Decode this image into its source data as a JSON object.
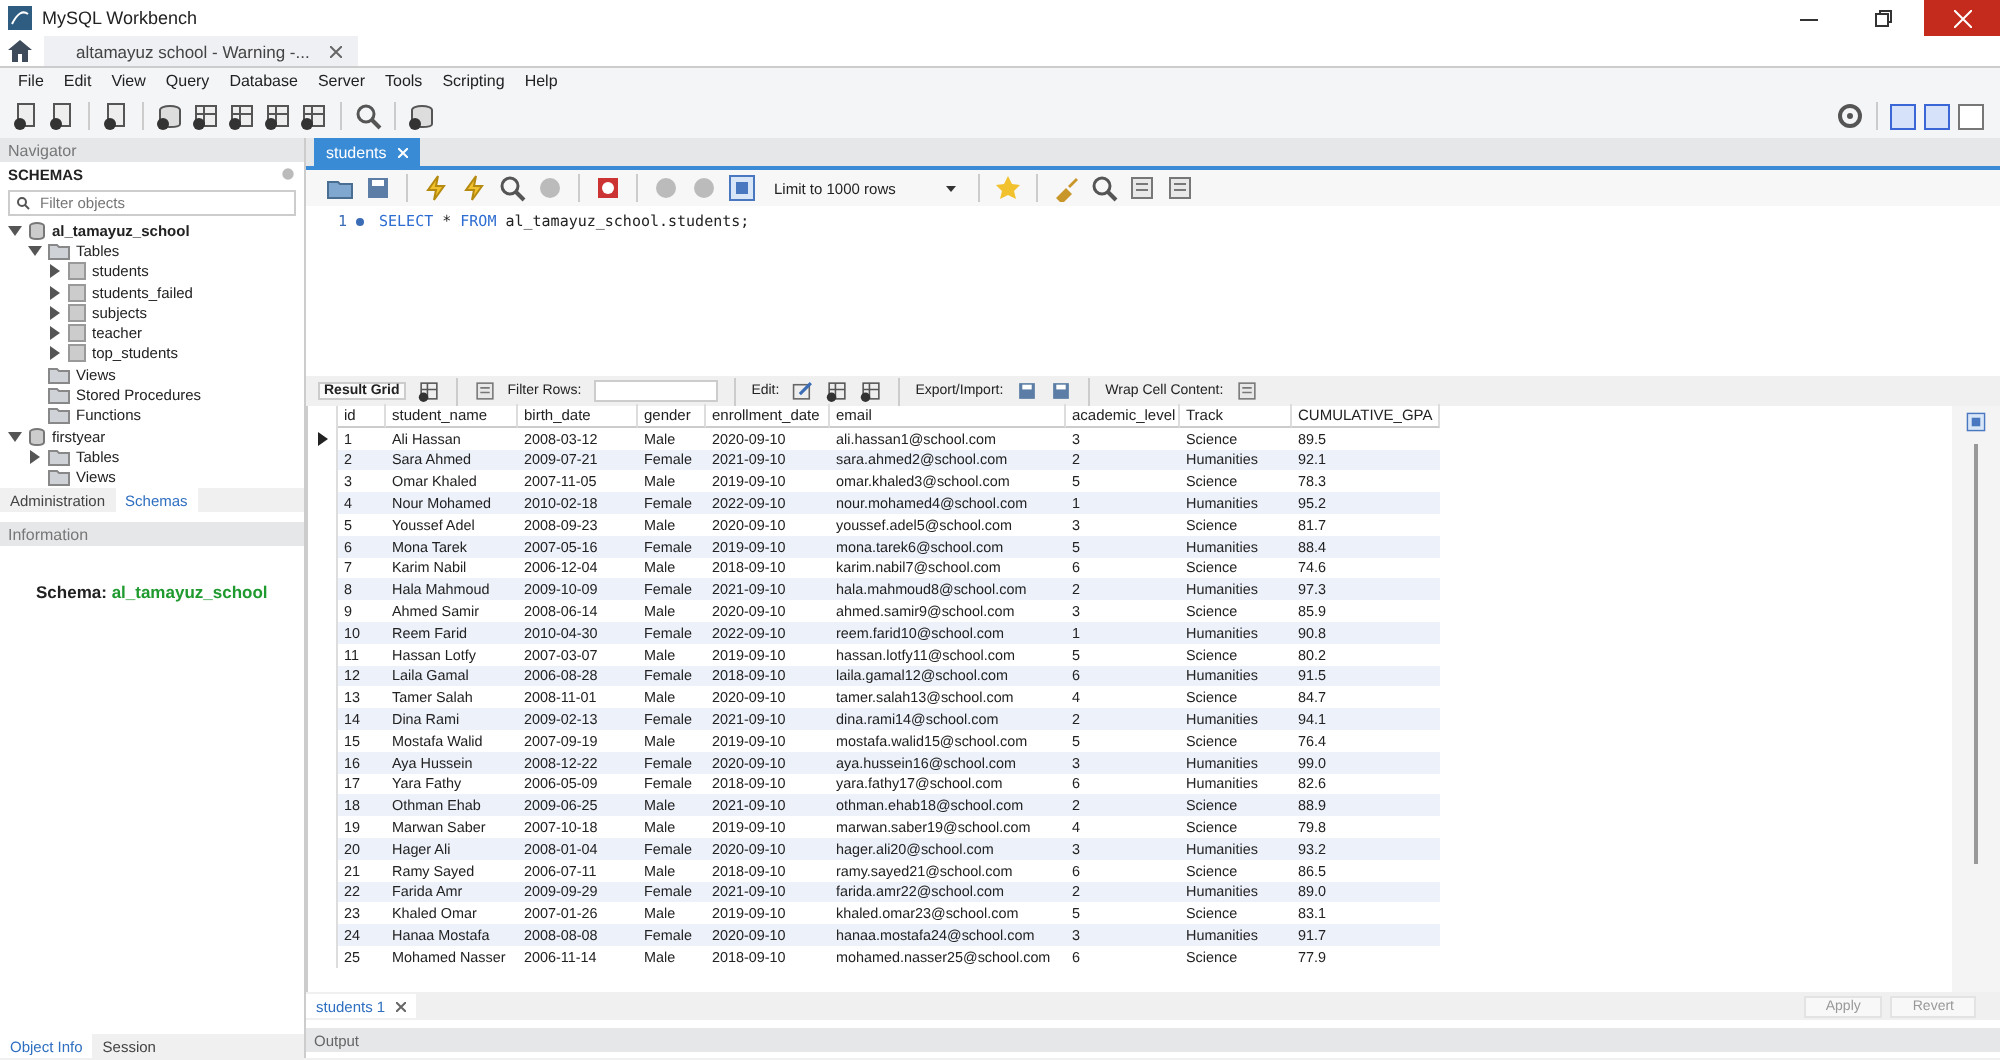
{
  "window": {
    "title": "MySQL Workbench",
    "tab": "altamayuz school - Warning -..."
  },
  "menu": [
    "File",
    "Edit",
    "View",
    "Query",
    "Database",
    "Server",
    "Tools",
    "Scripting",
    "Help"
  ],
  "layout_toggles": [
    {
      "on": true
    },
    {
      "on": true
    },
    {
      "on": false
    }
  ],
  "navigator": {
    "title": "Navigator",
    "schemas_label": "SCHEMAS",
    "filter_placeholder": "Filter objects",
    "tree": [
      {
        "label": "al_tamayuz_school",
        "kind": "schema",
        "default": true,
        "expanded": true,
        "children": [
          {
            "label": "Tables",
            "kind": "folder",
            "expanded": true,
            "children": [
              {
                "label": "students",
                "kind": "table",
                "expanded": false
              },
              {
                "label": "students_failed",
                "kind": "table",
                "expanded": false
              },
              {
                "label": "subjects",
                "kind": "table",
                "expanded": false
              },
              {
                "label": "teacher",
                "kind": "table",
                "expanded": false
              },
              {
                "label": "top_students",
                "kind": "table",
                "expanded": false
              }
            ]
          },
          {
            "label": "Views",
            "kind": "folder"
          },
          {
            "label": "Stored Procedures",
            "kind": "folder"
          },
          {
            "label": "Functions",
            "kind": "folder"
          }
        ]
      },
      {
        "label": "firstyear",
        "kind": "schema",
        "default": false,
        "expanded": true,
        "children": [
          {
            "label": "Tables",
            "kind": "folder",
            "expanded": false
          },
          {
            "label": "Views",
            "kind": "folder"
          }
        ]
      }
    ],
    "tabs": [
      {
        "label": "Administration",
        "selected": false
      },
      {
        "label": "Schemas",
        "selected": true
      }
    ]
  },
  "information": {
    "title": "Information",
    "schema_label": "Schema:",
    "schema_name": "al_tamayuz_school",
    "tabs": [
      {
        "label": "Object Info",
        "selected": true
      },
      {
        "label": "Session",
        "selected": false
      }
    ]
  },
  "editor": {
    "tab": "students",
    "limit": "Limit to 1000 rows",
    "line_number": "1",
    "sql": [
      {
        "text": "SELECT",
        "kind": "keyword"
      },
      {
        "text": " * ",
        "kind": "plain"
      },
      {
        "text": "FROM",
        "kind": "keyword"
      },
      {
        "text": " al_tamayuz_school.students;",
        "kind": "plain"
      }
    ]
  },
  "result": {
    "view_label": "Result Grid",
    "filter_label": "Filter Rows:",
    "edit_label": "Edit:",
    "export_label": "Export/Import:",
    "wrap_label": "Wrap Cell Content:",
    "columns": [
      "id",
      "student_name",
      "birth_date",
      "gender",
      "enrollment_date",
      "email",
      "academic_level",
      "Track",
      "CUMULATIVE_GPA"
    ],
    "rows": [
      {
        "selected": true,
        "cells": [
          "1",
          "Ali Hassan",
          "2008-03-12",
          "Male",
          "2020-09-10",
          "ali.hassan1@school.com",
          "3",
          "Science",
          "89.5"
        ]
      },
      {
        "selected": false,
        "cells": [
          "2",
          "Sara Ahmed",
          "2009-07-21",
          "Female",
          "2021-09-10",
          "sara.ahmed2@school.com",
          "2",
          "Humanities",
          "92.1"
        ]
      },
      {
        "selected": false,
        "cells": [
          "3",
          "Omar Khaled",
          "2007-11-05",
          "Male",
          "2019-09-10",
          "omar.khaled3@school.com",
          "5",
          "Science",
          "78.3"
        ]
      },
      {
        "selected": false,
        "cells": [
          "4",
          "Nour Mohamed",
          "2010-02-18",
          "Female",
          "2022-09-10",
          "nour.mohamed4@school.com",
          "1",
          "Humanities",
          "95.2"
        ]
      },
      {
        "selected": false,
        "cells": [
          "5",
          "Youssef Adel",
          "2008-09-23",
          "Male",
          "2020-09-10",
          "youssef.adel5@school.com",
          "3",
          "Science",
          "81.7"
        ]
      },
      {
        "selected": false,
        "cells": [
          "6",
          "Mona Tarek",
          "2007-05-16",
          "Female",
          "2019-09-10",
          "mona.tarek6@school.com",
          "5",
          "Humanities",
          "88.4"
        ]
      },
      {
        "selected": false,
        "cells": [
          "7",
          "Karim Nabil",
          "2006-12-04",
          "Male",
          "2018-09-10",
          "karim.nabil7@school.com",
          "6",
          "Science",
          "74.6"
        ]
      },
      {
        "selected": false,
        "cells": [
          "8",
          "Hala Mahmoud",
          "2009-10-09",
          "Female",
          "2021-09-10",
          "hala.mahmoud8@school.com",
          "2",
          "Humanities",
          "97.3"
        ]
      },
      {
        "selected": false,
        "cells": [
          "9",
          "Ahmed Samir",
          "2008-06-14",
          "Male",
          "2020-09-10",
          "ahmed.samir9@school.com",
          "3",
          "Science",
          "85.9"
        ]
      },
      {
        "selected": false,
        "cells": [
          "10",
          "Reem Farid",
          "2010-04-30",
          "Female",
          "2022-09-10",
          "reem.farid10@school.com",
          "1",
          "Humanities",
          "90.8"
        ]
      },
      {
        "selected": false,
        "cells": [
          "11",
          "Hassan Lotfy",
          "2007-03-07",
          "Male",
          "2019-09-10",
          "hassan.lotfy11@school.com",
          "5",
          "Science",
          "80.2"
        ]
      },
      {
        "selected": false,
        "cells": [
          "12",
          "Laila Gamal",
          "2006-08-28",
          "Female",
          "2018-09-10",
          "laila.gamal12@school.com",
          "6",
          "Humanities",
          "91.5"
        ]
      },
      {
        "selected": false,
        "cells": [
          "13",
          "Tamer Salah",
          "2008-11-01",
          "Male",
          "2020-09-10",
          "tamer.salah13@school.com",
          "4",
          "Science",
          "84.7"
        ]
      },
      {
        "selected": false,
        "cells": [
          "14",
          "Dina Rami",
          "2009-02-13",
          "Female",
          "2021-09-10",
          "dina.rami14@school.com",
          "2",
          "Humanities",
          "94.1"
        ]
      },
      {
        "selected": false,
        "cells": [
          "15",
          "Mostafa Walid",
          "2007-09-19",
          "Male",
          "2019-09-10",
          "mostafa.walid15@school.com",
          "5",
          "Science",
          "76.4"
        ]
      },
      {
        "selected": false,
        "cells": [
          "16",
          "Aya Hussein",
          "2008-12-22",
          "Female",
          "2020-09-10",
          "aya.hussein16@school.com",
          "3",
          "Humanities",
          "99.0"
        ]
      },
      {
        "selected": false,
        "cells": [
          "17",
          "Yara Fathy",
          "2006-05-09",
          "Female",
          "2018-09-10",
          "yara.fathy17@school.com",
          "6",
          "Humanities",
          "82.6"
        ]
      },
      {
        "selected": false,
        "cells": [
          "18",
          "Othman Ehab",
          "2009-06-25",
          "Male",
          "2021-09-10",
          "othman.ehab18@school.com",
          "2",
          "Science",
          "88.9"
        ]
      },
      {
        "selected": false,
        "cells": [
          "19",
          "Marwan Saber",
          "2007-10-18",
          "Male",
          "2019-09-10",
          "marwan.saber19@school.com",
          "4",
          "Science",
          "79.8"
        ]
      },
      {
        "selected": false,
        "cells": [
          "20",
          "Hager Ali",
          "2008-01-04",
          "Female",
          "2020-09-10",
          "hager.ali20@school.com",
          "3",
          "Humanities",
          "93.2"
        ]
      },
      {
        "selected": false,
        "cells": [
          "21",
          "Ramy Sayed",
          "2006-07-11",
          "Male",
          "2018-09-10",
          "ramy.sayed21@school.com",
          "6",
          "Science",
          "86.5"
        ]
      },
      {
        "selected": false,
        "cells": [
          "22",
          "Farida Amr",
          "2009-09-29",
          "Female",
          "2021-09-10",
          "farida.amr22@school.com",
          "2",
          "Humanities",
          "89.0"
        ]
      },
      {
        "selected": false,
        "cells": [
          "23",
          "Khaled Omar",
          "2007-01-26",
          "Male",
          "2019-09-10",
          "khaled.omar23@school.com",
          "5",
          "Science",
          "83.1"
        ]
      },
      {
        "selected": false,
        "cells": [
          "24",
          "Hanaa Mostafa",
          "2008-08-08",
          "Female",
          "2020-09-10",
          "hanaa.mostafa24@school.com",
          "3",
          "Humanities",
          "91.7"
        ]
      },
      {
        "selected": false,
        "cells": [
          "25",
          "Mohamed Nasser",
          "2006-11-14",
          "Male",
          "2018-09-10",
          "mohamed.nasser25@school.com",
          "6",
          "Science",
          "77.9"
        ]
      }
    ],
    "tabs": [
      {
        "label": "students 1",
        "selected": true
      }
    ],
    "buttons": [
      "Apply",
      "Revert"
    ]
  },
  "output": {
    "title": "Output"
  }
}
